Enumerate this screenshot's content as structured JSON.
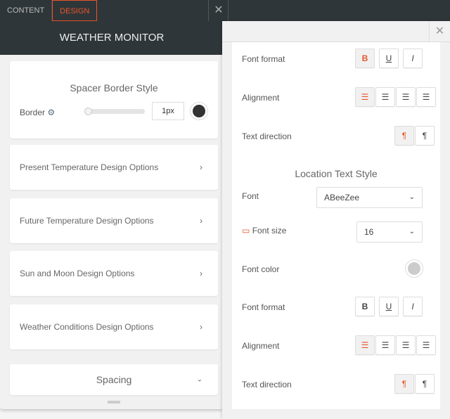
{
  "tabs": {
    "content": "CONTENT",
    "design": "DESIGN",
    "close": "✕"
  },
  "header": {
    "title": "WEATHER MONITOR"
  },
  "spacer": {
    "title": "Spacer Border Style",
    "border_label": "Border",
    "border_value": "1px",
    "slider_fraction": 0,
    "color": "#333333"
  },
  "sections": [
    {
      "label": "Present Temperature Design Options"
    },
    {
      "label": "Future Temperature Design Options"
    },
    {
      "label": "Sun and Moon Design Options"
    },
    {
      "label": "Weather Conditions Design Options"
    }
  ],
  "spacing": {
    "label": "Spacing"
  },
  "panel": {
    "close": "✕",
    "top": {
      "font_format": "Font format",
      "alignment": "Alignment",
      "text_direction": "Text direction"
    },
    "location": {
      "title": "Location Text Style",
      "font_label": "Font",
      "font_value": "ABeeZee",
      "size_label": "Font size",
      "size_value": "16",
      "color_label": "Font color",
      "color": "#cccccc",
      "font_format": "Font format",
      "alignment": "Alignment",
      "text_direction": "Text direction"
    },
    "glyphs": {
      "bold": "B",
      "underline": "U",
      "italic": "I",
      "ltr": "¶",
      "rtl": "¶"
    }
  },
  "accent": "#e8552b"
}
